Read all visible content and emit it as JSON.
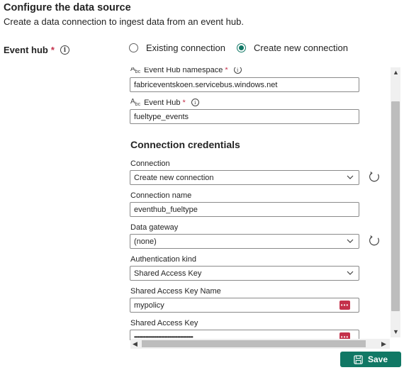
{
  "header": {
    "title": "Configure the data source",
    "subtitle": "Create a data connection to ingest data from an event hub."
  },
  "event_hub": {
    "label": "Event hub",
    "required": "*",
    "info": "i",
    "options": [
      {
        "label": "Existing connection",
        "selected": false
      },
      {
        "label": "Create new connection",
        "selected": true
      }
    ]
  },
  "form": {
    "namespace": {
      "label": "Event Hub namespace",
      "required": "*",
      "info": "i",
      "value": "fabriceventskoen.servicebus.windows.net"
    },
    "event_hub_name": {
      "label": "Event Hub",
      "required": "*",
      "info": "i",
      "value": "fueltype_events"
    },
    "credentials_heading": "Connection credentials",
    "connection": {
      "label": "Connection",
      "value": "Create new connection"
    },
    "connection_name": {
      "label": "Connection name",
      "value": "eventhub_fueltype"
    },
    "data_gateway": {
      "label": "Data gateway",
      "value": "(none)"
    },
    "auth_kind": {
      "label": "Authentication kind",
      "value": "Shared Access Key"
    },
    "sak_name": {
      "label": "Shared Access Key Name",
      "value": "mypolicy"
    },
    "sak": {
      "label": "Shared Access Key",
      "value": "••••••••••••••••••••••••••••••••••••••••••••••"
    },
    "field_icon": "abc-text-icon"
  },
  "footer": {
    "save_label": "Save"
  },
  "colors": {
    "accent": "#117865",
    "required": "#c4314b",
    "password_icon": "#c4314b"
  }
}
